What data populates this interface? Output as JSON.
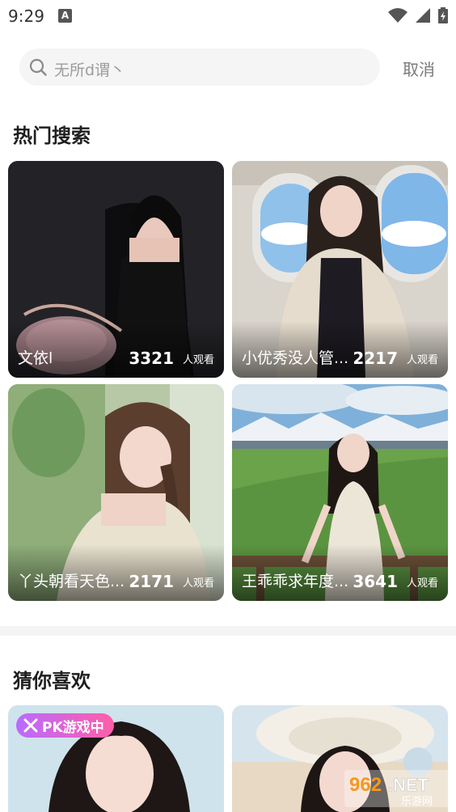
{
  "status": {
    "time": "9:29",
    "notif_icon": "A"
  },
  "search": {
    "placeholder": "无所d谓丶",
    "cancel_label": "取消"
  },
  "hot": {
    "title": "热门搜索",
    "unit": "人观看",
    "cards": [
      {
        "name": "文依l",
        "count": "3321"
      },
      {
        "name": "小优秀没人管...",
        "count": "2217"
      },
      {
        "name": "丫头朝看天色...",
        "count": "2171"
      },
      {
        "name": "王乖乖求年度...",
        "count": "3641"
      }
    ]
  },
  "guess": {
    "title": "猜你喜欢",
    "badge": "PK游戏中"
  },
  "watermark": {
    "main": "962.NET",
    "sub": "乐游网"
  }
}
